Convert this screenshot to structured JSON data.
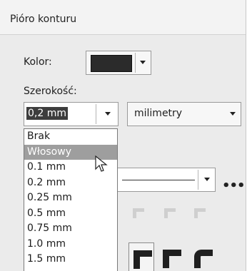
{
  "dialog": {
    "title": "Pióro konturu"
  },
  "color": {
    "label": "Kolor:",
    "swatch": "#2b2b2b",
    "arrow_icon": "chevron-down-icon"
  },
  "width": {
    "label": "Szerokość:",
    "value": "0,2 mm",
    "unit": "milimetry",
    "options": [
      "Brak",
      "Włosowy",
      "0.1 mm",
      "0.2 mm",
      "0.25 mm",
      "0.5 mm",
      "0.75 mm",
      "1.0 mm",
      "1.5 mm"
    ],
    "highlighted": "Włosowy"
  },
  "style": {
    "more_icon": "ellipsis-icon"
  },
  "colors": {
    "dialog_bg": "#ebebeb",
    "highlight": "#9e9e9e"
  }
}
